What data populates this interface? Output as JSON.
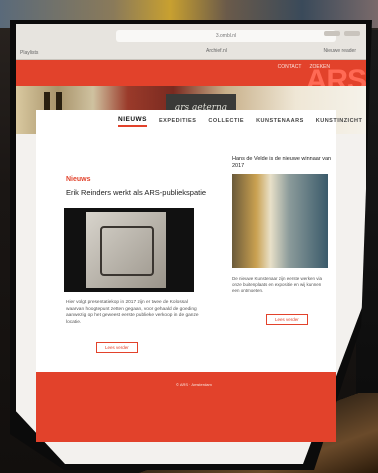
{
  "browser": {
    "url": "3.ombl.nl",
    "bookmarks_left": "Playlists",
    "bookmarks_center": "Archief.nl",
    "bookmarks_right": "Nieuwe reader"
  },
  "header": {
    "links": [
      "Contact",
      "Zoeken"
    ],
    "logo": "ARS"
  },
  "hero": {
    "sign_text": "ars aeterna"
  },
  "nav": {
    "items": [
      "Nieuws",
      "Expedities",
      "Collectie",
      "Kunstenaars",
      "Kunstinzicht"
    ],
    "active_index": 0
  },
  "main": {
    "section_title": "Nieuws",
    "card1": {
      "title": "Erik Reinders werkt als ARS-publiekspatie",
      "text": "Hier volgt presentatiekop in 2017 zijn er twee de Kolossal waarvan hoogtepunt zetten gegaan, voor gehaald de goeding aanwezig op het geweest eerste publieke verkoop in de ganze locatie.",
      "read_more": "Lees verder"
    },
    "card2": {
      "title": "Hans de Velde is de nieuwe winnaar van 2017",
      "text": "De nieuwe Kunstenaar zijn eerste werken via onze buitenplaats en expositie en wij kunnen een ontmoeten.",
      "read_more": "Lees verder"
    }
  },
  "footer": {
    "text": "© ARS · Amsterdam"
  },
  "colors": {
    "accent": "#e2422b",
    "page_bg": "#f3f1ee"
  }
}
